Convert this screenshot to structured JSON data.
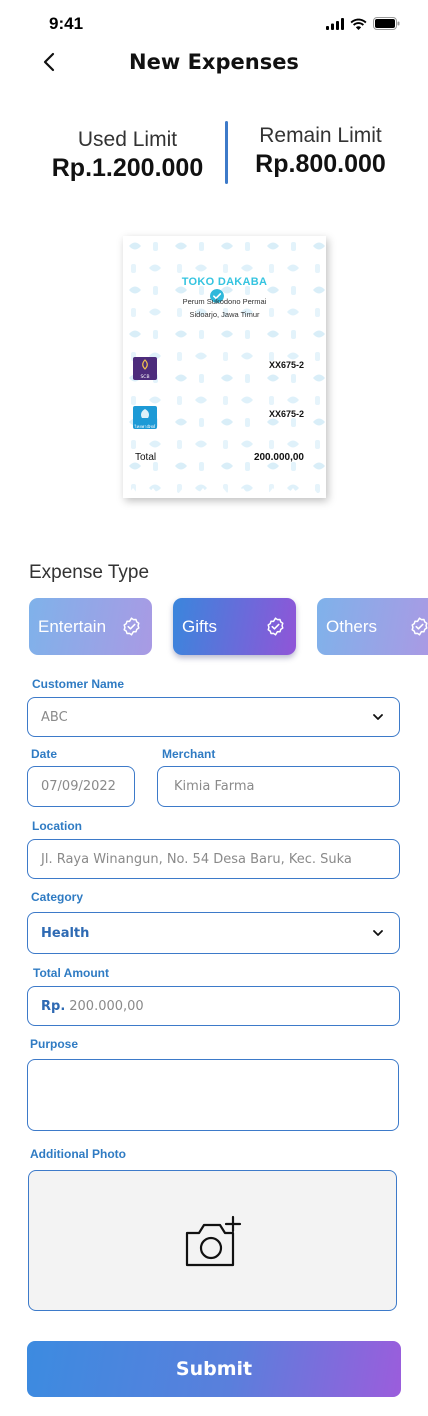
{
  "status_bar": {
    "time": "9:41"
  },
  "header": {
    "title": "New Expenses"
  },
  "limits": {
    "used_label": "Used Limit",
    "used_value": "Rp.1.200.000",
    "remain_label": "Remain Limit",
    "remain_value": "Rp.800.000"
  },
  "receipt": {
    "store_name": "TOKO DAKABA",
    "address_line1": "Perum Sukodono Permai",
    "address_line2": "Sidoarjo, Jawa Timur",
    "payments": [
      {
        "bank": "SCB",
        "code": "XX675-2"
      },
      {
        "bank": "ไทยพาณิชย์",
        "code": "XX675-2"
      }
    ],
    "total_label": "Total",
    "total_value": "200.000,00"
  },
  "expense_type": {
    "title": "Expense Type",
    "options": [
      {
        "label": "Entertain",
        "icon": "badge-check-icon"
      },
      {
        "label": "Gifts",
        "icon": "badge-check-icon",
        "selected": true
      },
      {
        "label": "Others",
        "icon": "badge-check-icon"
      }
    ]
  },
  "form": {
    "customer_name": {
      "label": "Customer Name",
      "value": "ABC"
    },
    "date": {
      "label": "Date",
      "value": "07/09/2022"
    },
    "merchant": {
      "label": "Merchant",
      "value": "Kimia Farma"
    },
    "location": {
      "label": "Location",
      "value": "Jl. Raya Winangun, No. 54 Desa Baru, Kec. Suka"
    },
    "category": {
      "label": "Category",
      "value": "Health"
    },
    "total_amount": {
      "label": "Total Amount",
      "prefix": "Rp.",
      "value": "200.000,00"
    },
    "purpose": {
      "label": "Purpose",
      "value": ""
    },
    "additional_photo": {
      "label": "Additional Photo",
      "icon": "add-camera-icon"
    }
  },
  "submit_label": "Submit",
  "colors": {
    "accent": "#3d7ac9",
    "gradient_start": "#3c8be0",
    "gradient_end": "#9b5ddc",
    "label_blue": "#2f7bc3"
  }
}
